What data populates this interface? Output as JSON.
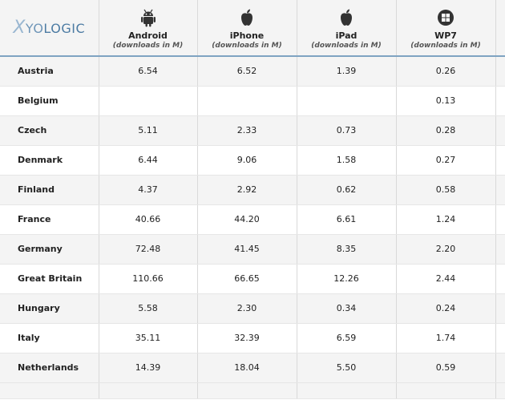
{
  "logo_text": "XYOLOGIC",
  "chart_data": {
    "type": "table",
    "columns": [
      {
        "name": "Android",
        "unit": "(downloads in M)",
        "icon": "android-icon"
      },
      {
        "name": "iPhone",
        "unit": "(downloads in M)",
        "icon": "apple-icon"
      },
      {
        "name": "iPad",
        "unit": "(downloads in M)",
        "icon": "apple-icon"
      },
      {
        "name": "WP7",
        "unit": "(downloads in M)",
        "icon": "windows-icon"
      }
    ],
    "rows": [
      {
        "country": "Austria",
        "values": [
          "6.54",
          "6.52",
          "1.39",
          "0.26"
        ]
      },
      {
        "country": "Belgium",
        "values": [
          "",
          "",
          "",
          "0.13"
        ]
      },
      {
        "country": "Czech",
        "values": [
          "5.11",
          "2.33",
          "0.73",
          "0.28"
        ]
      },
      {
        "country": "Denmark",
        "values": [
          "6.44",
          "9.06",
          "1.58",
          "0.27"
        ]
      },
      {
        "country": "Finland",
        "values": [
          "4.37",
          "2.92",
          "0.62",
          "0.58"
        ]
      },
      {
        "country": "France",
        "values": [
          "40.66",
          "44.20",
          "6.61",
          "1.24"
        ]
      },
      {
        "country": "Germany",
        "values": [
          "72.48",
          "41.45",
          "8.35",
          "2.20"
        ]
      },
      {
        "country": "Great Britain",
        "values": [
          "110.66",
          "66.65",
          "12.26",
          "2.44"
        ]
      },
      {
        "country": "Hungary",
        "values": [
          "5.58",
          "2.30",
          "0.34",
          "0.24"
        ]
      },
      {
        "country": "Italy",
        "values": [
          "35.11",
          "32.39",
          "6.59",
          "1.74"
        ]
      },
      {
        "country": "Netherlands",
        "values": [
          "14.39",
          "18.04",
          "5.50",
          "0.59"
        ]
      }
    ]
  }
}
